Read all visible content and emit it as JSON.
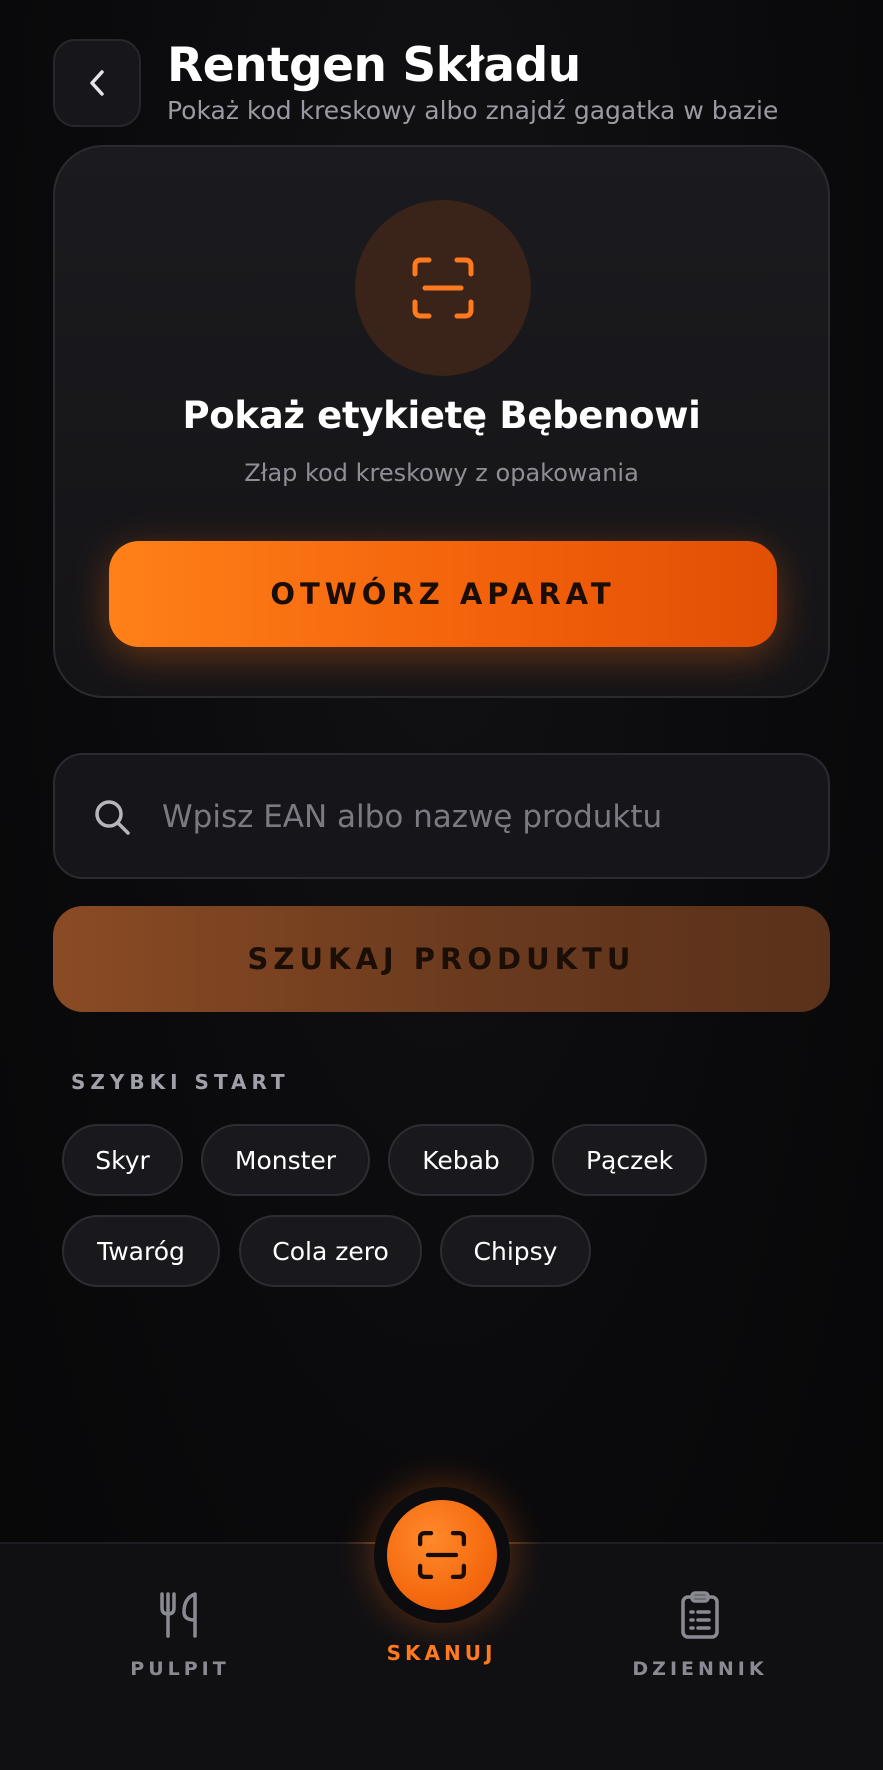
{
  "header": {
    "back_icon": "chevron-left-icon",
    "title": "Rentgen Składu",
    "subtitle": "Pokaż kod kreskowy albo znajdź gagatka w bazie"
  },
  "scan_card": {
    "icon": "scan-barcode-icon",
    "title": "Pokaż etykietę Bębenowi",
    "subtitle": "Złap kod kreskowy z opakowania",
    "button_label": "OTWÓRZ APARAT"
  },
  "search": {
    "icon": "search-icon",
    "placeholder": "Wpisz EAN albo nazwę produktu",
    "value": "",
    "button_label": "SZUKAJ PRODUKTU"
  },
  "quick_start": {
    "label": "SZYBKI START",
    "chips": [
      "Skyr",
      "Monster",
      "Kebab",
      "Pączek",
      "Twaróg",
      "Cola zero",
      "Chipsy"
    ]
  },
  "bottom_nav": {
    "items": [
      {
        "label": "PULPIT",
        "icon": "fork-knife-icon",
        "active": false
      },
      {
        "label": "SKANUJ",
        "icon": "scan-barcode-icon",
        "active": true
      },
      {
        "label": "DZIENNIK",
        "icon": "clipboard-icon",
        "active": false
      }
    ]
  },
  "colors": {
    "accent": "#f56a10",
    "background": "#09090b",
    "card": "#17171b",
    "muted_text": "#8e8e96"
  }
}
